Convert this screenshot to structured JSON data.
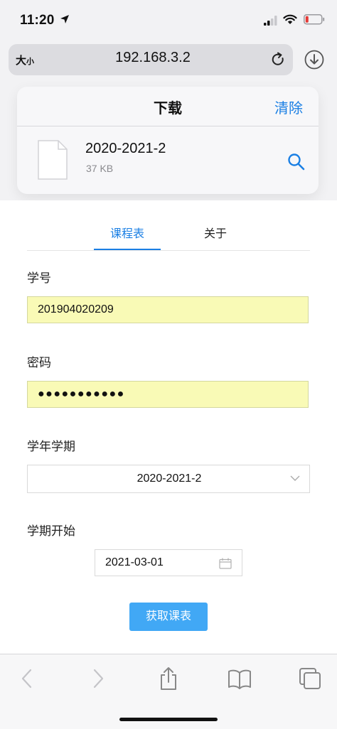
{
  "status_bar": {
    "time": "11:20"
  },
  "address_bar": {
    "text_size_big": "大",
    "text_size_small": "小",
    "url": "192.168.3.2"
  },
  "downloads": {
    "title": "下载",
    "clear_label": "清除",
    "file": {
      "name": "2020-2021-2",
      "size": "37 KB"
    }
  },
  "tabs": [
    {
      "label": "课程表"
    },
    {
      "label": "关于"
    }
  ],
  "form": {
    "student_id_label": "学号",
    "student_id_value": "201904020209",
    "password_label": "密码",
    "password_value": "●●●●●●●●●●●",
    "term_label": "学年学期",
    "term_value": "2020-2021-2",
    "term_start_label": "学期开始",
    "term_start_value": "2021-03-01",
    "submit_label": "获取课表"
  },
  "colors": {
    "accent": "#1a7fe4",
    "button": "#41a8f5",
    "autofill": "#f9fab6"
  }
}
